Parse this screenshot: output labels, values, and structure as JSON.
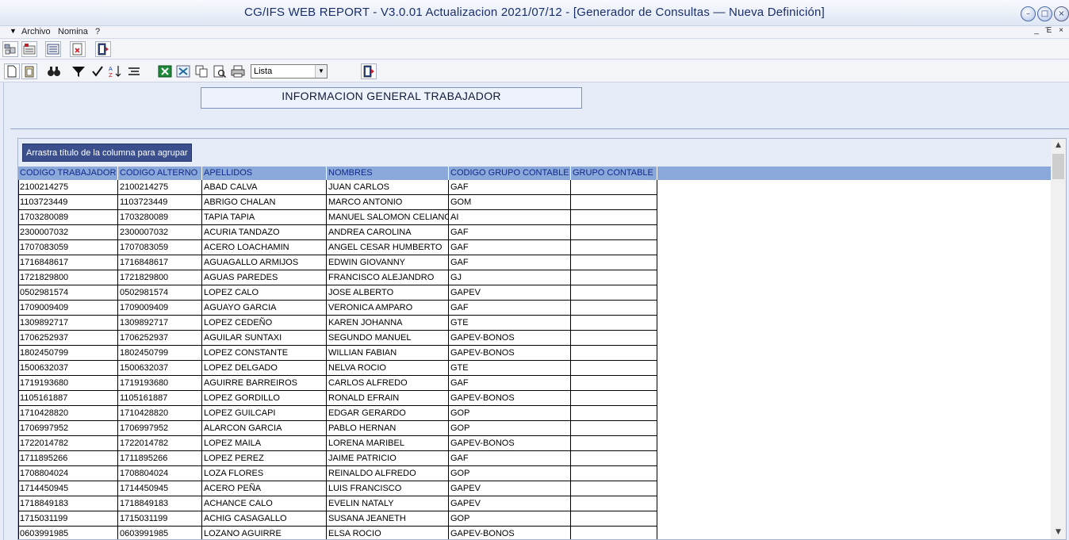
{
  "window": {
    "title": "CG/IFS WEB REPORT - V3.0.01 Actualizacion 2021/07/12 - [Generador de Consultas  — Nueva Definición]",
    "minimize": "–",
    "restore": "□",
    "close": "×"
  },
  "menu": {
    "system": "▼",
    "items": [
      "Archivo",
      "Nomina",
      "?"
    ],
    "mdi_controls": "_ Έ ×"
  },
  "toolbar2": {
    "view_combo_value": "Lista"
  },
  "report": {
    "title": "INFORMACION GENERAL TRABAJADOR"
  },
  "grid": {
    "group_hint": "Arrastra título de la columna para agrupar",
    "columns": [
      "CODIGO TRABAJADOR",
      "CODIGO ALTERNO",
      "APELLIDOS",
      "NOMBRES",
      "CODIGO GRUPO CONTABLE",
      "GRUPO CONTABLE"
    ],
    "rows": [
      [
        "2100214275",
        "2100214275",
        "ABAD CALVA",
        "JUAN CARLOS",
        "GAF",
        ""
      ],
      [
        "1103723449",
        "1103723449",
        "ABRIGO CHALAN",
        "MARCO ANTONIO",
        "GOM",
        ""
      ],
      [
        "1703280089",
        "1703280089",
        "TAPIA TAPIA",
        "MANUEL SALOMON CELIANO",
        "AI",
        ""
      ],
      [
        "2300007032",
        "2300007032",
        "ACURIA TANDAZO",
        "ANDREA CAROLINA",
        "GAF",
        ""
      ],
      [
        "1707083059",
        "1707083059",
        "ACERO LOACHAMIN",
        "ANGEL CESAR HUMBERTO",
        "GAF",
        ""
      ],
      [
        "1716848617",
        "1716848617",
        "AGUAGALLO ARMIJOS",
        " EDWIN GIOVANNY",
        "GAF",
        ""
      ],
      [
        "1721829800",
        "1721829800",
        "AGUAS PAREDES",
        "FRANCISCO ALEJANDRO",
        "GJ",
        ""
      ],
      [
        "0502981574",
        "0502981574",
        "LOPEZ CALO",
        "JOSE ALBERTO",
        "GAPEV",
        ""
      ],
      [
        "1709009409",
        "1709009409",
        "AGUAYO GARCIA",
        "VERONICA AMPARO",
        "GAF",
        ""
      ],
      [
        "1309892717",
        "1309892717",
        "LOPEZ CEDEÑO",
        "KAREN JOHANNA",
        "GTE",
        ""
      ],
      [
        "1706252937",
        "1706252937",
        "AGUILAR SUNTAXI",
        "SEGUNDO MANUEL",
        "GAPEV-BONOS",
        ""
      ],
      [
        "1802450799",
        "1802450799",
        "LOPEZ CONSTANTE",
        "WILLIAN FABIAN",
        "GAPEV-BONOS",
        ""
      ],
      [
        "1500632037",
        "1500632037",
        "LOPEZ DELGADO",
        "NELVA ROCIO",
        "GTE",
        ""
      ],
      [
        "1719193680",
        "1719193680",
        "AGUIRRE BARREIROS",
        "CARLOS ALFREDO",
        "GAF",
        ""
      ],
      [
        "1105161887",
        "1105161887",
        "LOPEZ GORDILLO",
        "RONALD EFRAIN",
        "GAPEV-BONOS",
        ""
      ],
      [
        "1710428820",
        "1710428820",
        "LOPEZ GUILCAPI",
        "EDGAR GERARDO",
        "GOP",
        ""
      ],
      [
        "1706997952",
        "1706997952",
        "ALARCON GARCIA",
        "PABLO HERNAN",
        "GOP",
        ""
      ],
      [
        "1722014782",
        "1722014782",
        "LOPEZ MAILA",
        "LORENA MARIBEL",
        "GAPEV-BONOS",
        ""
      ],
      [
        "1711895266",
        "1711895266",
        "LOPEZ PEREZ",
        "JAIME PATRICIO",
        "GAF",
        ""
      ],
      [
        "1708804024",
        "1708804024",
        "LOZA FLORES",
        "REINALDO ALFREDO",
        "GOP",
        ""
      ],
      [
        "1714450945",
        "1714450945",
        "ACERO PEÑA",
        "LUIS FRANCISCO",
        "GAPEV",
        ""
      ],
      [
        "1718849183",
        "1718849183",
        "ACHANCE CALO",
        "EVELIN NATALY",
        "GAPEV",
        ""
      ],
      [
        "1715031199",
        "1715031199",
        "ACHIG CASAGALLO",
        "SUSANA JEANETH",
        "GOP",
        ""
      ],
      [
        "0603991985",
        "0603991985",
        "LOZANO AGUIRRE",
        "ELSA ROCIO",
        "GAPEV-BONOS",
        ""
      ]
    ]
  },
  "icons": {
    "toolbar1": [
      "users-icon",
      "calculator-icon",
      "form-icon",
      "delete-document-icon",
      "exit-icon"
    ],
    "toolbar2": [
      "new-document-icon",
      "clipboard-icon",
      "binoculars-icon",
      "filter-icon",
      "checkmark-icon",
      "sort-az-icon",
      "align-icon",
      "excel-icon",
      "excel-export-icon",
      "copy-icon",
      "print-preview-icon",
      "printer-icon",
      "exit-icon"
    ]
  }
}
